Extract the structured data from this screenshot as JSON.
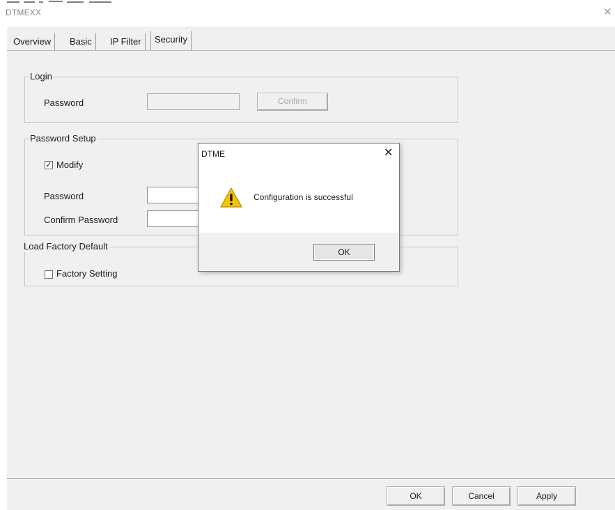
{
  "window": {
    "title": "DTMEXX",
    "close_icon": "close-icon"
  },
  "tabs": [
    {
      "label": "Overview",
      "active": false
    },
    {
      "label": "Basic",
      "active": false
    },
    {
      "label": "IP Filter",
      "active": false
    },
    {
      "label": "Security",
      "active": true
    }
  ],
  "login": {
    "legend": "Login",
    "password_label": "Password",
    "password_value": "",
    "confirm_label": "Confirm"
  },
  "password_setup": {
    "legend": "Password Setup",
    "modify_label": "Modify",
    "modify_checked": true,
    "password_label": "Password",
    "password_value": "",
    "confirm_password_label": "Confirm Password",
    "confirm_password_value": ""
  },
  "factory_default": {
    "legend": "Load Factory Default",
    "factory_setting_label": "Factory Setting",
    "factory_setting_checked": false
  },
  "footer": {
    "ok_label": "OK",
    "cancel_label": "Cancel",
    "apply_label": "Apply"
  },
  "dialog": {
    "title": "DTME",
    "icon": "warning-icon",
    "message": "Configuration is successful",
    "ok_label": "OK"
  },
  "colors": {
    "window_bg": "#f0f0f0",
    "warning_yellow": "#f2c500"
  }
}
